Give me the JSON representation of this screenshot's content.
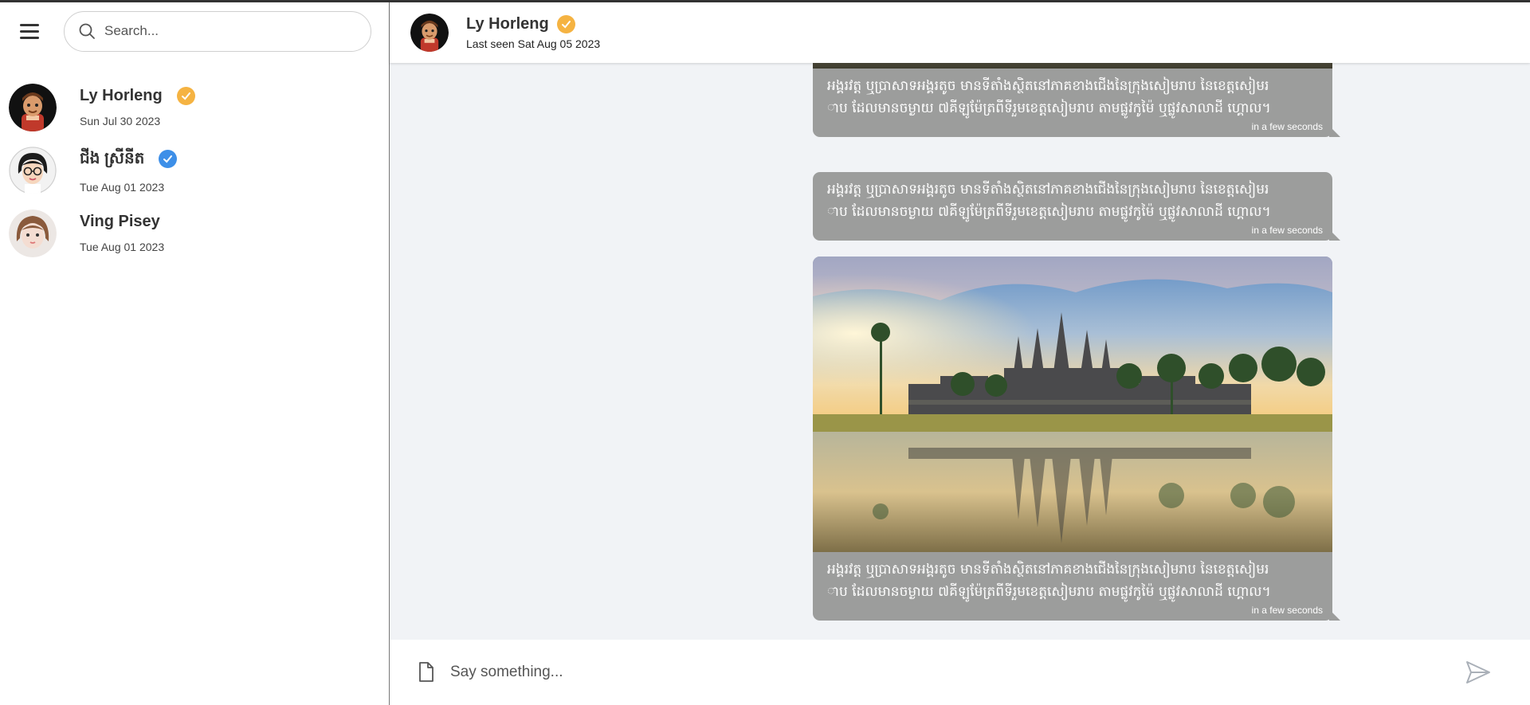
{
  "colors": {
    "accent_orange": "#f5b342",
    "accent_blue": "#3d8fe8",
    "bubble_gray": "#9c9d9c",
    "chat_bg": "#f1f3f6"
  },
  "sidebar": {
    "menu_icon": "hamburger-icon",
    "search": {
      "placeholder": "Search...",
      "value": ""
    },
    "contacts": [
      {
        "name": "Ly Horleng",
        "date": "Sun Jul 30 2023",
        "verified": "orange"
      },
      {
        "name": "ជីង ស្រីនីត",
        "date": "Tue Aug 01 2023",
        "verified": "blue"
      },
      {
        "name": "Ving Pisey",
        "date": "Tue Aug 01 2023",
        "verified": "none"
      }
    ]
  },
  "chat": {
    "header": {
      "name": "Ly Horleng",
      "status": "Last seen Sat Aug 05 2023"
    },
    "messages": [
      {
        "type": "image",
        "line1": "អង្គរវត្ត ឬប្រាសាទអង្គរតូច មានទីតាំងស្ថិតនៅភាគខាងជើងនៃក្រុងសៀមរាប នៃខេត្តសៀមរ",
        "line2": "ាប ដែលមានចម្ងាយ ៧គីឡូម៉ែត្រពីទីរួមខេត្តសៀមរាប តាមផ្លូវកូម៉ៃ ឬផ្លូវសាលាដី ហ្គោល។",
        "time": "in a few seconds"
      },
      {
        "type": "text",
        "line1": "អង្គរវត្ត ឬប្រាសាទអង្គរតូច មានទីតាំងស្ថិតនៅភាគខាងជើងនៃក្រុងសៀមរាប នៃខេត្តសៀមរ",
        "line2": "ាប ដែលមានចម្ងាយ ៧គីឡូម៉ែត្រពីទីរួមខេត្តសៀមរាប តាមផ្លូវកូម៉ៃ ឬផ្លូវសាលាដី ហ្គោល។",
        "time": "in a few seconds"
      },
      {
        "type": "image",
        "line1": "អង្គរវត្ត ឬប្រាសាទអង្គរតូច មានទីតាំងស្ថិតនៅភាគខាងជើងនៃក្រុងសៀមរាប នៃខេត្តសៀមរ",
        "line2": "ាប ដែលមានចម្ងាយ ៧គីឡូម៉ែត្រពីទីរួមខេត្តសៀមរាប តាមផ្លូវកូម៉ៃ ឬផ្លូវសាលាដី ហ្គោល។",
        "time": "in a few seconds"
      }
    ],
    "composer": {
      "placeholder": "Say something...",
      "value": ""
    }
  }
}
